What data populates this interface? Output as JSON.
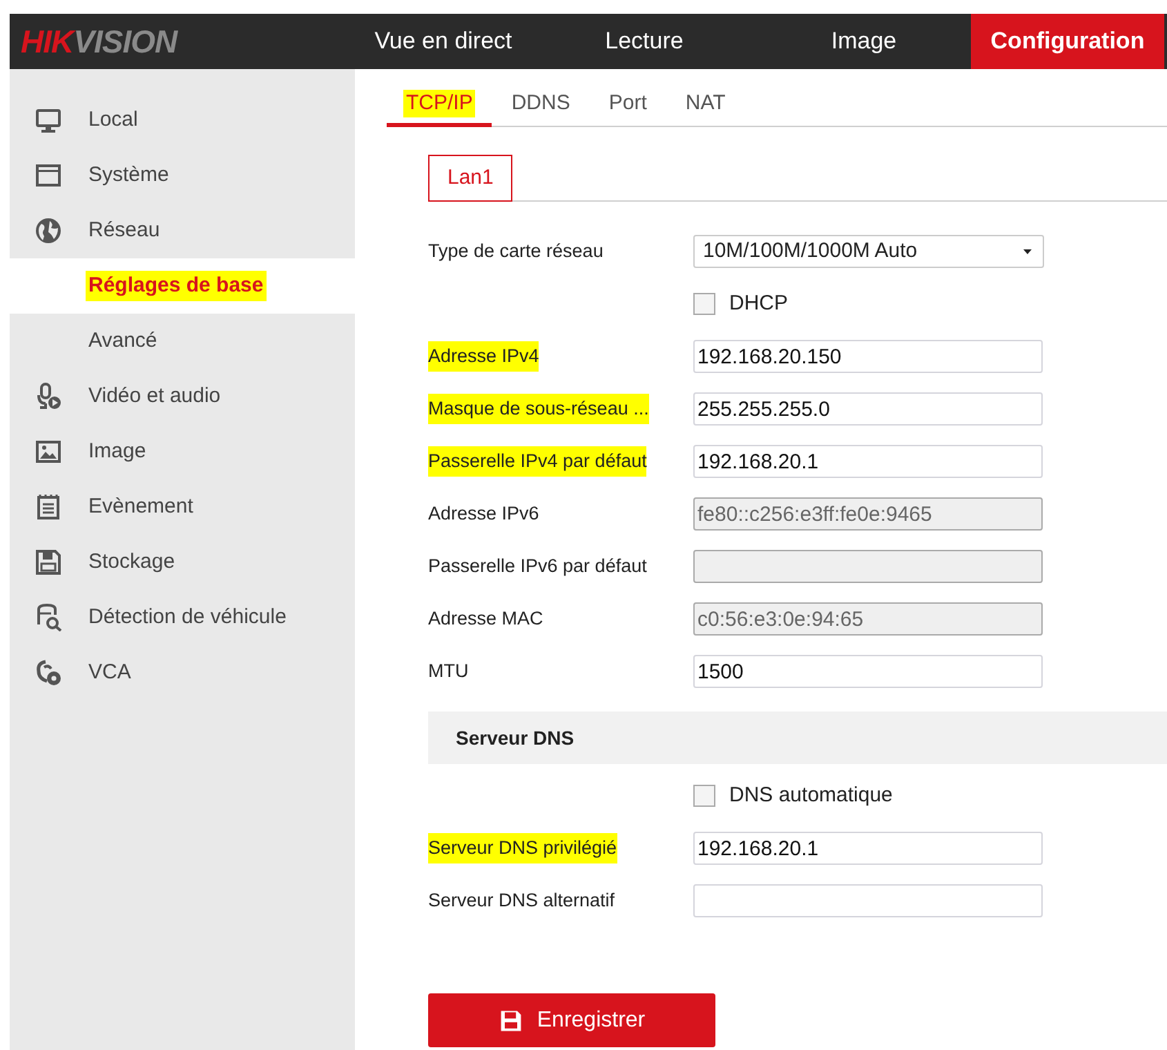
{
  "header": {
    "logo": {
      "primary": "HIK",
      "secondary": "VISION"
    },
    "nav": [
      {
        "label": "Vue en direct",
        "selected": false
      },
      {
        "label": "Lecture",
        "selected": false
      },
      {
        "label": "Image",
        "selected": false
      },
      {
        "label": "Configuration",
        "selected": true
      }
    ]
  },
  "sidebar": {
    "items": [
      {
        "label": "Local",
        "selected": false,
        "highlighted": false
      },
      {
        "label": "Système",
        "selected": false,
        "highlighted": false
      },
      {
        "label": "Réseau",
        "selected": false,
        "highlighted": false,
        "children": [
          {
            "label": "Réglages de base",
            "selected": true,
            "highlighted": true
          },
          {
            "label": "Avancé",
            "selected": false,
            "highlighted": false
          }
        ]
      },
      {
        "label": "Vidéo et audio",
        "selected": false,
        "highlighted": false
      },
      {
        "label": "Image",
        "selected": false,
        "highlighted": false
      },
      {
        "label": "Evènement",
        "selected": false,
        "highlighted": false
      },
      {
        "label": "Stockage",
        "selected": false,
        "highlighted": false
      },
      {
        "label": "Détection de véhicule",
        "selected": false,
        "highlighted": false
      },
      {
        "label": "VCA",
        "selected": false,
        "highlighted": false
      }
    ]
  },
  "tabs": [
    {
      "label": "TCP/IP",
      "selected": true,
      "highlighted": true
    },
    {
      "label": "DDNS",
      "selected": false,
      "highlighted": false
    },
    {
      "label": "Port",
      "selected": false,
      "highlighted": false
    },
    {
      "label": "NAT",
      "selected": false,
      "highlighted": false
    }
  ],
  "subtabs": [
    {
      "label": "Lan1",
      "selected": true
    }
  ],
  "form": [
    {
      "kind": "select",
      "label": "Type de carte réseau",
      "value": "10M/100M/1000M Auto",
      "highlighted": false
    },
    {
      "kind": "checkbox",
      "label": "DHCP",
      "checked": false
    },
    {
      "kind": "text",
      "label": "Adresse IPv4",
      "value": "192.168.20.150",
      "disabled": false,
      "highlighted": true
    },
    {
      "kind": "text",
      "label": "Masque de sous-réseau ...",
      "value": "255.255.255.0",
      "disabled": false,
      "highlighted": true
    },
    {
      "kind": "text",
      "label": "Passerelle IPv4 par défaut",
      "value": "192.168.20.1",
      "disabled": false,
      "highlighted": true
    },
    {
      "kind": "text",
      "label": "Adresse IPv6",
      "value": "fe80::c256:e3ff:fe0e:9465",
      "disabled": true,
      "highlighted": false
    },
    {
      "kind": "text",
      "label": "Passerelle IPv6 par défaut",
      "disabled": true,
      "highlighted": false
    },
    {
      "kind": "text",
      "label": "Adresse MAC",
      "value": "c0:56:e3:0e:94:65",
      "disabled": true,
      "highlighted": false
    },
    {
      "kind": "text",
      "label": "MTU",
      "value": "1500",
      "disabled": false,
      "highlighted": false
    },
    {
      "kind": "section",
      "label": "Serveur DNS"
    },
    {
      "kind": "checkbox",
      "label": "DNS automatique",
      "checked": false
    },
    {
      "kind": "text",
      "label": "Serveur DNS privilégié",
      "value": "192.168.20.1",
      "disabled": false,
      "highlighted": true
    },
    {
      "kind": "text",
      "label": "Serveur DNS alternatif",
      "disabled": false,
      "highlighted": false
    }
  ],
  "save_button": {
    "label": "Enregistrer"
  }
}
